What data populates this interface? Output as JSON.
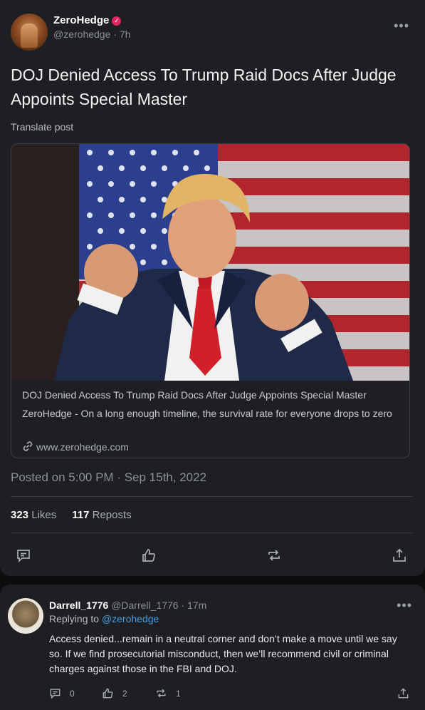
{
  "post": {
    "author_name": "ZeroHedge",
    "verified_badge": "verified-icon",
    "handle": "@zerohedge",
    "time": "7h",
    "more_icon": "more-horizontal-icon",
    "headline": "DOJ Denied Access To Trump Raid Docs After Judge Appoints Special Master",
    "translate_label": "Translate post",
    "link_card": {
      "title": "DOJ Denied Access To Trump Raid Docs After Judge Appoints Special Master",
      "description": "ZeroHedge - On a long enough timeline, the survival rate for everyone drops to zero",
      "domain": "www.zerohedge.com",
      "domain_icon": "link-icon"
    },
    "posted_on": "Posted on 5:00 PM · Sep 15th, 2022",
    "likes_count": "323",
    "likes_label": "Likes",
    "reposts_count": "117",
    "reposts_label": "Reposts",
    "actions": [
      "comment-icon",
      "like-icon",
      "repost-icon",
      "share-icon"
    ]
  },
  "reply": {
    "author_name": "Darrell_1776",
    "handle": "@Darrell_1776",
    "time": "17m",
    "replying_prefix": "Replying to",
    "replying_to": "@zerohedge",
    "body": "Access denied...remain in a neutral corner and don’t make a move until we say so. If we find prosecutorial misconduct, then we’ll recommend civil or criminal charges against those in the FBI and DOJ.",
    "comments": "0",
    "likes": "2",
    "reposts": "1"
  },
  "colors": {
    "background": "#1e1f22",
    "page": "#0d0d0d",
    "link_blue": "#4b9be0",
    "badge_red": "#e0245e"
  }
}
